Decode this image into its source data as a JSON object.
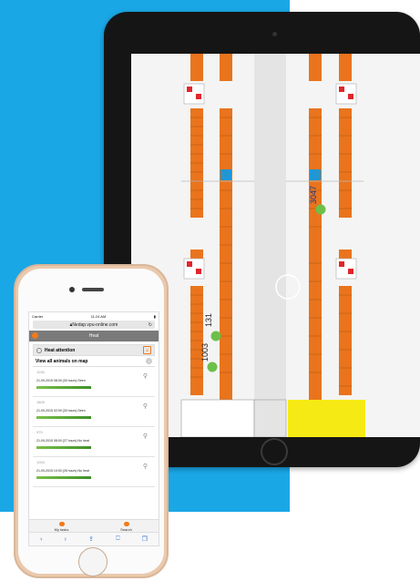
{
  "phone": {
    "status": {
      "carrier": "Carrier",
      "time": "11:24 AM"
    },
    "url": "Nedap.vpu-online.com",
    "header_title": "Heat",
    "heat_attention": {
      "label": "Heat attention",
      "count": "2"
    },
    "view_map": "View all animals on map",
    "animals": [
      {
        "number": "1290",
        "meta": "21-09-2015 08:09 (30 hours) Seen"
      },
      {
        "number": "1805",
        "meta": "21-09-2015 02:09 (30 hours) Seen"
      },
      {
        "number": "975",
        "meta": "21-09-2015 08:00 (27 hours) No heat"
      },
      {
        "number": "1004",
        "meta": "21-09-2015 10:00 (26 hours) No heat"
      }
    ],
    "tabs": [
      {
        "label": "My tasks"
      },
      {
        "label": "Search"
      }
    ],
    "accent": "#f07a1a"
  },
  "map": {
    "labels": [
      "131",
      "1003",
      "3047"
    ],
    "colors": {
      "stall": "#e9741d",
      "marker": "#6cc04a",
      "yellow": "#f6ea15",
      "blue": "#2196d3",
      "red": "#e0252d"
    }
  },
  "background": {
    "blue": "#1aa7e6"
  }
}
